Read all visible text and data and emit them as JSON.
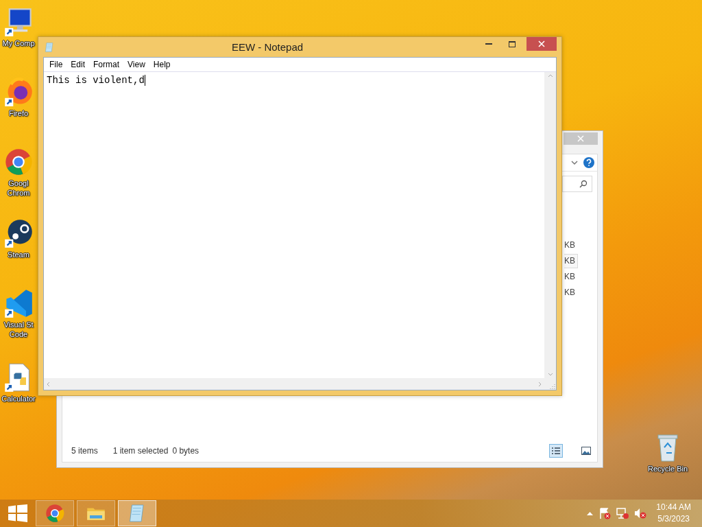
{
  "desktop_icons": [
    {
      "kind": "computer",
      "label": "My Comp"
    },
    {
      "kind": "firefox",
      "label": "Firefo"
    },
    {
      "kind": "chrome",
      "label": "Googl\nChrom"
    },
    {
      "kind": "steam",
      "label": "Steam"
    },
    {
      "kind": "vscode",
      "label": "Visual St\nCode"
    },
    {
      "kind": "python",
      "label": "Calculator"
    }
  ],
  "recycle_bin": {
    "label": "Recycle Bin"
  },
  "explorer": {
    "sizes": [
      {
        "text": "KB",
        "selected": false
      },
      {
        "text": "KB",
        "selected": true
      },
      {
        "text": "KB",
        "selected": false
      },
      {
        "text": "KB",
        "selected": false
      }
    ],
    "status": {
      "items": "5 items",
      "selection": "1 item selected",
      "bytes": "0 bytes"
    },
    "views": [
      {
        "kind": "details",
        "selected": true
      },
      {
        "kind": "large_icons",
        "selected": false
      }
    ]
  },
  "notepad": {
    "title": "EEW - Notepad",
    "menu": [
      "File",
      "Edit",
      "Format",
      "View",
      "Help"
    ],
    "content": "This is violent,d"
  },
  "taskbar": {
    "apps": [
      {
        "kind": "chrome",
        "selected": false
      },
      {
        "kind": "explorer",
        "selected": false
      },
      {
        "kind": "notepad",
        "selected": true
      }
    ],
    "time": "10:44 AM",
    "date": "5/3/2023"
  }
}
